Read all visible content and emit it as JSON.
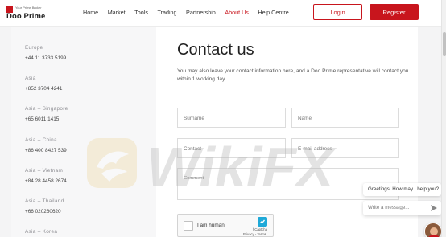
{
  "header": {
    "logo": {
      "tagline": "Your Prime Broker",
      "name": "Doo Prime"
    },
    "nav": [
      "Home",
      "Market",
      "Tools",
      "Trading",
      "Partnership",
      "About Us",
      "Help Centre"
    ],
    "active_nav": "About Us",
    "login_label": "Login",
    "register_label": "Register"
  },
  "contacts": [
    {
      "region": "Europe",
      "phone": "+44 11 3733 5199"
    },
    {
      "region": "Asia",
      "phone": "+852 3704 4241"
    },
    {
      "region": "Asia – Singapore",
      "phone": "+65 6011 1415"
    },
    {
      "region": "Asia – China",
      "phone": "+86 400 8427 539"
    },
    {
      "region": "Asia – Vietnam",
      "phone": "+84 28 4458 2674"
    },
    {
      "region": "Asia – Thailand",
      "phone": "+66 020260620"
    },
    {
      "region": "Asia – Korea",
      "phone": ""
    }
  ],
  "form": {
    "title": "Contact us",
    "description": "You may also leave your contact information here, and a Doo Prime representative will contact you within 1 working day.",
    "surname_placeholder": "Surname",
    "name_placeholder": "Name",
    "contact_placeholder": "Contact",
    "email_placeholder": "E-mail address",
    "comment_placeholder": "Comment"
  },
  "recaptcha": {
    "label": "I am human",
    "brand": "hCaptcha",
    "links": "Privacy - Terms"
  },
  "watermark": {
    "text": "WikiFX"
  },
  "chat": {
    "greeting": "Greetings! How may I help you?",
    "input_placeholder": "Write a message..."
  },
  "colors": {
    "brand_red": "#c8151d",
    "left_bg": "#f7f7f8",
    "page_bg": "#f4f4f5"
  }
}
